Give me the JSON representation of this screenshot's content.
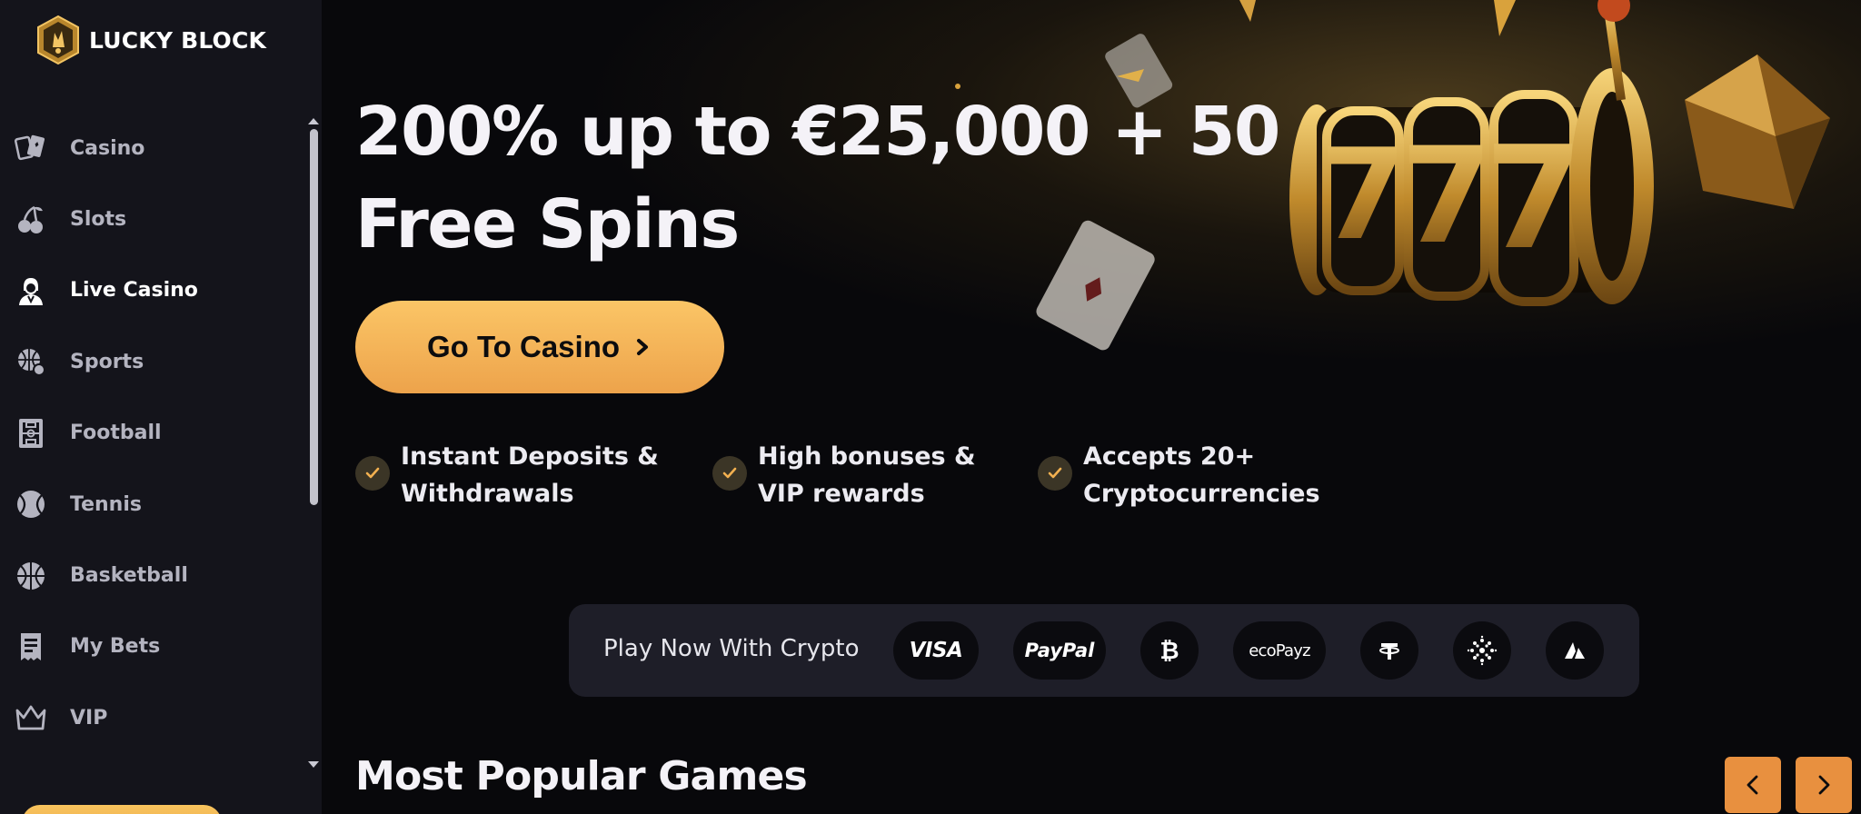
{
  "brand": {
    "name": "LUCKY BLOCK"
  },
  "sidebar": {
    "items": [
      {
        "label": "Casino",
        "icon": "playing-cards-icon"
      },
      {
        "label": "Slots",
        "icon": "cherries-icon"
      },
      {
        "label": "Live Casino",
        "icon": "dealer-icon"
      },
      {
        "label": "Sports",
        "icon": "sports-ball-icon"
      },
      {
        "label": "Football",
        "icon": "football-pitch-icon"
      },
      {
        "label": "Tennis",
        "icon": "tennis-ball-icon"
      },
      {
        "label": "Basketball",
        "icon": "basketball-icon"
      },
      {
        "label": "My Bets",
        "icon": "receipt-icon"
      },
      {
        "label": "VIP",
        "icon": "crown-icon"
      }
    ]
  },
  "hero": {
    "title_line1": "200% up to €25,000 + 50",
    "title_line2": "Free Spins",
    "cta_label": "Go To Casino",
    "features": [
      {
        "line1": "Instant Deposits &",
        "line2": "Withdrawals"
      },
      {
        "line1": "High bonuses &",
        "line2": "VIP rewards"
      },
      {
        "line1": "Accepts 20+",
        "line2": "Cryptocurrencies"
      }
    ]
  },
  "payments": {
    "label": "Play Now With Crypto",
    "methods": {
      "visa": "VISA",
      "paypal": "PayPal",
      "bitcoin": "bitcoin-icon",
      "ecopayz": "ecoPayz",
      "tether": "tether-icon",
      "cardano": "cardano-icon",
      "avalanche": "avalanche-icon"
    }
  },
  "popular": {
    "title": "Most Popular Games"
  },
  "colors": {
    "accent": "#f2b050",
    "sidebar_bg": "#14141b",
    "main_bg": "#08080b",
    "nav_arrow": "#e8903f"
  }
}
